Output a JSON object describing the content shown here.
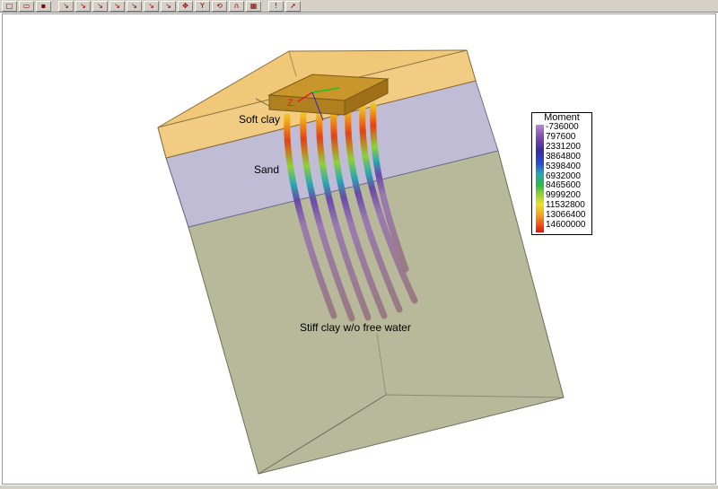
{
  "toolbar": {
    "buttons": [
      {
        "icon": "new-file-icon",
        "glyph": "□"
      },
      {
        "icon": "open-folder-icon",
        "glyph": "▭"
      },
      {
        "icon": "save-icon",
        "glyph": "▪"
      },
      {
        "icon": "view-axis-1-icon",
        "glyph": "↘"
      },
      {
        "icon": "view-axis-2-icon",
        "glyph": "↘"
      },
      {
        "icon": "view-axis-3-icon",
        "glyph": "↘"
      },
      {
        "icon": "view-axis-4-icon",
        "glyph": "↘"
      },
      {
        "icon": "view-axis-5-icon",
        "glyph": "↘"
      },
      {
        "icon": "view-axis-6-icon",
        "glyph": "↘"
      },
      {
        "icon": "view-axis-7-icon",
        "glyph": "↘"
      },
      {
        "icon": "move-icon",
        "glyph": "✥"
      },
      {
        "icon": "filter-icon",
        "glyph": "Y"
      },
      {
        "icon": "rotate-icon",
        "glyph": "⟲"
      },
      {
        "icon": "perspective-icon",
        "glyph": "∩"
      },
      {
        "icon": "grid-icon",
        "glyph": "▦"
      },
      {
        "icon": "info-icon",
        "glyph": "!"
      },
      {
        "icon": "select-pointer-icon",
        "glyph": "➚"
      }
    ]
  },
  "scene": {
    "layers": {
      "soft_clay": "Soft clay",
      "sand": "Sand",
      "stiff_clay": "Stiff clay w/o free water"
    },
    "axis_label": "Z",
    "colors": {
      "soft_clay": "#f0c878",
      "sand": "#c0bcd6",
      "stiff_clay": "#b8b89a",
      "cap": "#c8962a"
    }
  },
  "legend": {
    "title": "Moment",
    "values": [
      "-736000",
      "797600",
      "2331200",
      "3864800",
      "5398400",
      "6932000",
      "8465600",
      "9999200",
      "11532800",
      "13066400",
      "14600000"
    ]
  }
}
